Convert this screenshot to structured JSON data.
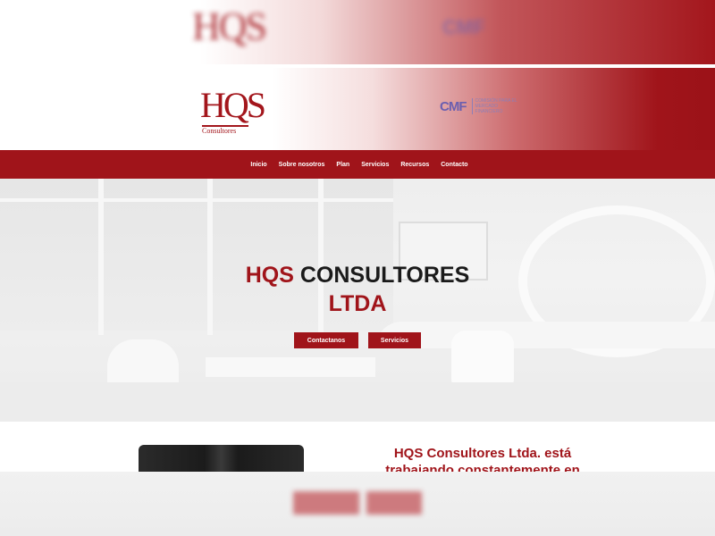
{
  "brand": {
    "logo_text": "HQS",
    "logo_sub": "Consultores",
    "cmf_mark": "CMF",
    "cmf_text": "Comisión para el Mercado Financiero",
    "primary_color": "#a0141a",
    "cmf_color": "#6b5fb0"
  },
  "nav": {
    "items": [
      "Inicio",
      "Sobre nosotros",
      "Plan",
      "Servicios",
      "Recursos",
      "Contacto"
    ]
  },
  "hero": {
    "title_accent": "HQS",
    "title_rest": "CONSULTORES",
    "title_line2": "LTDA",
    "buttons": [
      "Contactanos",
      "Servicios"
    ]
  },
  "about": {
    "title": "HQS Consultores Ltda. está trabajando constantemente en"
  }
}
